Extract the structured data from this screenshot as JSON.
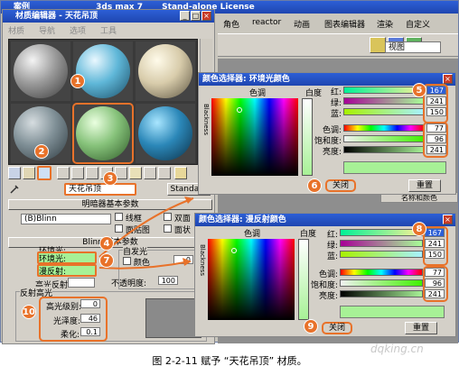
{
  "bg_window": {
    "title_left": "案例",
    "title_mid": "3ds max 7",
    "title_right": "Stand-alone License",
    "menu": [
      "角色",
      "reactor",
      "动画",
      "图表编辑器",
      "渲染",
      "自定义"
    ],
    "viewport_select": "视图"
  },
  "material_editor": {
    "title": "材质编辑器 - 天花吊顶",
    "menu": [
      "材质",
      "导航",
      "选项",
      "工具"
    ],
    "material_name": "天花吊顶",
    "standard_btn": "Standard",
    "shader_rollout_title": "明暗器基本参数",
    "shader_select": "(B)Blinn",
    "shader_options": [
      "线框",
      "双面",
      "面贴图",
      "面状"
    ],
    "blinn_rollout_title": "Blinn 基本参数",
    "self_illum_label": "自发光",
    "color_label": "颜色",
    "color_value": "0",
    "opacity_label": "不透明度:",
    "opacity_value": "100",
    "ambient_label": "环境光:",
    "diffuse_label": "漫反射:",
    "specular_label": "高光反射:",
    "specular_group": "反射高光",
    "spec_level_label": "高光级别:",
    "spec_level_value": "0",
    "glossiness_label": "光泽度:",
    "glossiness_value": "46",
    "soften_label": "柔化:",
    "soften_value": "0.1"
  },
  "color_picker_ambient": {
    "title": "颜色选择器: 环境光颜色",
    "hue_label": "色调",
    "whiteness_label": "白度",
    "blackness_label": "Blackness",
    "red_label": "红:",
    "green_label": "绿:",
    "blue_label": "蓝:",
    "red": "167",
    "green": "241",
    "blue": "150",
    "hue_field_label": "色调:",
    "sat_label": "饱和度:",
    "val_label": "亮度:",
    "hue": "77",
    "sat": "96",
    "val": "241",
    "close": "关闭",
    "reset": "重置",
    "preview_color": "#a7f196"
  },
  "color_picker_diffuse": {
    "title": "颜色选择器: 漫反射颜色",
    "hue_label": "色调",
    "whiteness_label": "白度",
    "blackness_label": "Blackness",
    "red_label": "红:",
    "green_label": "绿:",
    "blue_label": "蓝:",
    "red": "167",
    "green": "241",
    "blue": "150",
    "hue_field_label": "色调:",
    "sat_label": "饱和度:",
    "val_label": "亮度:",
    "hue": "77",
    "sat": "96",
    "val": "241",
    "close": "关闭",
    "reset": "重置",
    "preview_color": "#a7f196"
  },
  "callouts": [
    "1",
    "2",
    "3",
    "4",
    "5",
    "6",
    "7",
    "8",
    "9",
    "10"
  ],
  "side_label": "名称和颜色",
  "caption": "图 2-2-11   赋予 “天花吊顶” 材质。",
  "watermark": "dqking.cn",
  "colors": {
    "accent": "#e8722a",
    "titlebar": "#2d5fd6",
    "swatch": "#a7f196"
  }
}
